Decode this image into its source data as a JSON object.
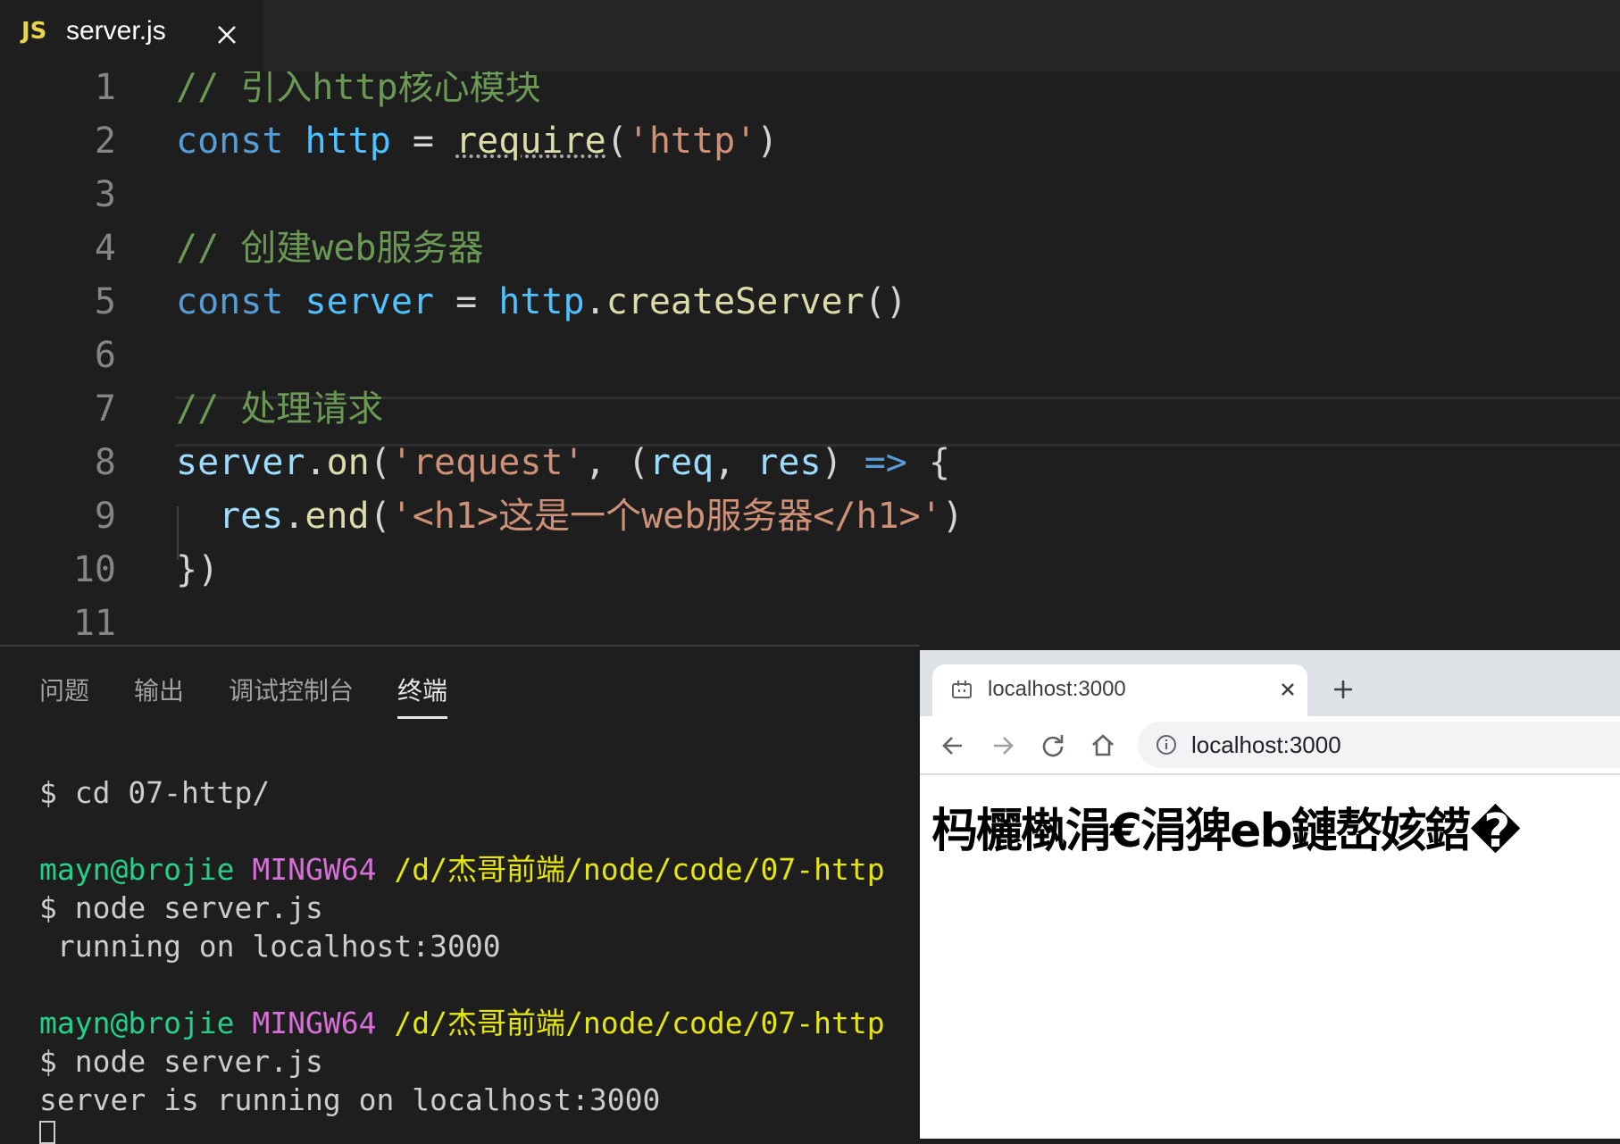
{
  "editor": {
    "tab": {
      "icon_text": "JS",
      "filename": "server.js"
    },
    "line_numbers": [
      "1",
      "2",
      "3",
      "4",
      "5",
      "6",
      "7",
      "8",
      "9",
      "10",
      "11"
    ],
    "lines": {
      "l1_comment": "// 引入http核心模块",
      "l2_const": "const",
      "l2_name": "http",
      "l2_eq": " = ",
      "l2_require": "require",
      "l2_paren_open": "(",
      "l2_string": "'http'",
      "l2_paren_close": ")",
      "l4_comment": "// 创建web服务器",
      "l5_const": "const",
      "l5_name": "server",
      "l5_eq": " = ",
      "l5_obj": "http",
      "l5_dot": ".",
      "l5_method": "createServer",
      "l5_parens": "()",
      "l7_comment": "// 处理请求",
      "l8_obj": "server",
      "l8_dot": ".",
      "l8_method": "on",
      "l8_paren_open": "(",
      "l8_string": "'request'",
      "l8_comma": ", (",
      "l8_req": "req",
      "l8_comma2": ", ",
      "l8_res": "res",
      "l8_paren_close": ") ",
      "l8_arrow": "=>",
      "l8_brace": " {",
      "l9_obj": "res",
      "l9_dot": ".",
      "l9_method": "end",
      "l9_paren_open": "(",
      "l9_string": "'<h1>这是一个web服务器</h1>'",
      "l9_paren_close": ")",
      "l10_close": "})"
    },
    "colors": {
      "comment": "#6a9955",
      "keyword": "#569cd6",
      "string": "#ce9178",
      "function": "#dcdcaa",
      "variable": "#9cdcfe"
    }
  },
  "panel": {
    "tabs": [
      {
        "label": "问题"
      },
      {
        "label": "输出"
      },
      {
        "label": "调试控制台"
      },
      {
        "label": "终端",
        "active": true
      }
    ],
    "terminal": {
      "l1": "$ cd 07-http/",
      "prompt_user": "mayn@brojie",
      "prompt_env": "MINGW64",
      "prompt_path": "/d/杰哥前端/node/code/07-http",
      "cmd": "$ node server.js",
      "out1": " running on localhost:3000",
      "out2": "server is running on localhost:3000"
    }
  },
  "browser": {
    "tab_title": "localhost:3000",
    "address": "localhost:3000",
    "page_heading": "杩欐槸涓€涓猈eb鏈嶅姟鍣�"
  }
}
